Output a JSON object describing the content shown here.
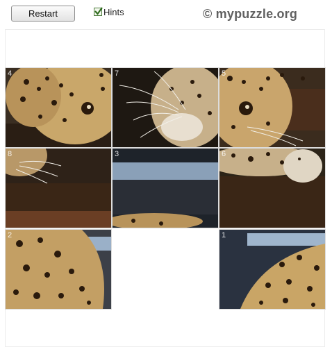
{
  "toolbar": {
    "restart_label": "Restart",
    "hints_label": "Hints",
    "hints_checked": true
  },
  "brand": {
    "text": "© mypuzzle.org"
  },
  "puzzle": {
    "grid_size": 3,
    "tiles": [
      {
        "hint": "4",
        "row": 0,
        "col": 0
      },
      {
        "hint": "7",
        "row": 0,
        "col": 1
      },
      {
        "hint": "5",
        "row": 0,
        "col": 2
      },
      {
        "hint": "8",
        "row": 1,
        "col": 0
      },
      {
        "hint": "3",
        "row": 1,
        "col": 1
      },
      {
        "hint": "6",
        "row": 1,
        "col": 2
      },
      {
        "hint": "2",
        "row": 2,
        "col": 0
      },
      {
        "hint": "1",
        "row": 2,
        "col": 2
      }
    ],
    "empty_slot": {
      "row": 2,
      "col": 1
    }
  }
}
